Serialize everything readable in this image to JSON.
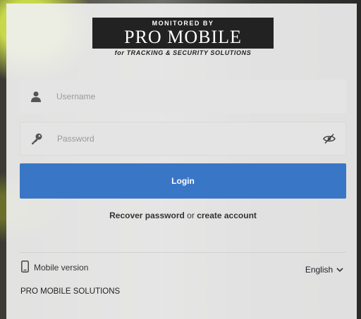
{
  "logo": {
    "top_line": "MONITORED BY",
    "main_text": "PRO MOBILE",
    "tagline": "for TRACKING & SECURITY SOLUTIONS"
  },
  "form": {
    "username_placeholder": "Username",
    "username_value": "",
    "password_placeholder": "Password",
    "password_value": "",
    "login_label": "Login"
  },
  "links": {
    "recover_password": "Recover password",
    "or": "or",
    "create_account": "create account"
  },
  "bottom": {
    "mobile_version": "Mobile version",
    "language": "English",
    "company": "PRO MOBILE SOLUTIONS"
  },
  "icons": {
    "username": "user-icon",
    "password": "key-icon",
    "toggle_password": "eye-slash-icon",
    "mobile": "phone-icon",
    "language": "chevron-down-icon"
  },
  "colors": {
    "accent": "#3a76c6"
  }
}
